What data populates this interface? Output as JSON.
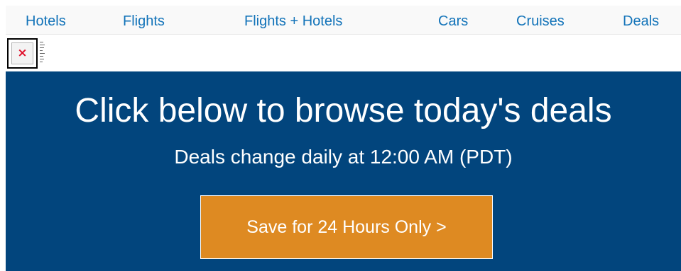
{
  "nav": {
    "items": [
      {
        "label": "Hotels"
      },
      {
        "label": "Flights"
      },
      {
        "label": "Flights + Hotels"
      },
      {
        "label": "Cars"
      },
      {
        "label": "Cruises"
      },
      {
        "label": "Deals"
      }
    ]
  },
  "broken_image": {
    "icon": "broken-image-icon",
    "glyph": "×"
  },
  "hero": {
    "headline": "Click below to browse today's deals",
    "subline": "Deals change daily at 12:00 AM (PDT)",
    "cta_label": "Save for 24 Hours Only >"
  },
  "colors": {
    "nav_link": "#1273b9",
    "hero_background": "#02457d",
    "cta_background": "#de8a22",
    "hero_text": "#ffffff"
  }
}
